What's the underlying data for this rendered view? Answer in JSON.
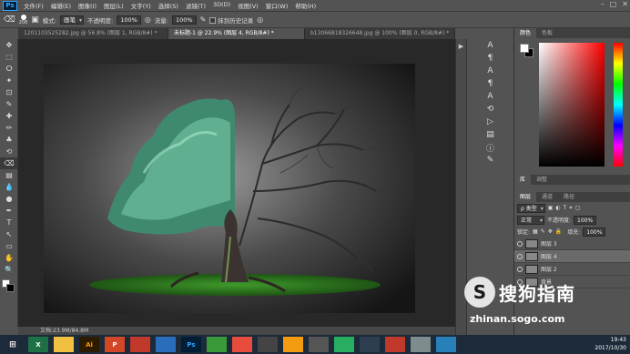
{
  "app": {
    "logo": "Ps"
  },
  "menu": [
    "文件(F)",
    "编辑(E)",
    "图像(I)",
    "图层(L)",
    "文字(Y)",
    "选择(S)",
    "滤镜(T)",
    "3D(D)",
    "视图(V)",
    "窗口(W)",
    "帮助(H)"
  ],
  "window_controls": [
    "–",
    "□",
    "✕"
  ],
  "options": {
    "brush_size": "208",
    "mode_label": "模式:",
    "mode_value": "画笔",
    "opacity_label": "不透明度:",
    "opacity_value": "100%",
    "flow_label": "流量:",
    "flow_value": "100%",
    "erase_history_label": "抹到历史记录"
  },
  "tabs": [
    {
      "label": "1201103525282.jpg @ 56.8% (图层 1, RGB/8#) *",
      "active": false
    },
    {
      "label": "未标题-1 @ 22.9% (图层 4, RGB/8#) *",
      "active": true
    },
    {
      "label": "b13066818326648.jpg @ 100% (图层 0, RGB/8#) *",
      "active": false
    }
  ],
  "tools": [
    "move-tool",
    "marquee-tool",
    "lasso-tool",
    "quick-select-tool",
    "crop-tool",
    "eyedropper-tool",
    "healing-tool",
    "brush-tool",
    "stamp-tool",
    "history-brush-tool",
    "eraser-tool",
    "gradient-tool",
    "blur-tool",
    "dodge-tool",
    "pen-tool",
    "type-tool",
    "path-select-tool",
    "shape-tool",
    "hand-tool",
    "zoom-tool"
  ],
  "status_text": "文档:23.9M/84.8M",
  "right_panel": {
    "color_tabs": [
      "颜色",
      "色板"
    ],
    "panel_tabs": [
      "库",
      "调整"
    ],
    "layer_tabs": [
      "图层",
      "通道",
      "路径"
    ],
    "kind_label": "ρ 类型",
    "blend_mode": "正常",
    "opacity_label": "不透明度:",
    "opacity_value": "100%",
    "lock_label": "锁定:",
    "fill_label": "填充:",
    "fill_value": "100%",
    "layers": [
      {
        "name": "图层 3",
        "selected": false
      },
      {
        "name": "图层 4",
        "selected": true
      },
      {
        "name": "图层 2",
        "selected": false
      },
      {
        "name": "背景",
        "selected": false
      }
    ]
  },
  "taskbar": {
    "items": [
      "X",
      "",
      "Ai",
      "P",
      "",
      "",
      "Ps",
      "",
      "",
      "",
      "",
      "",
      "",
      "",
      "",
      "",
      ""
    ],
    "time": "19:43",
    "date": "2017/10/30"
  },
  "watermark": {
    "logo": "S",
    "text": "搜狗指南",
    "url": "zhinan.sogo.com"
  },
  "colors": {
    "foreground": "#ffffff",
    "background": "#000000"
  }
}
